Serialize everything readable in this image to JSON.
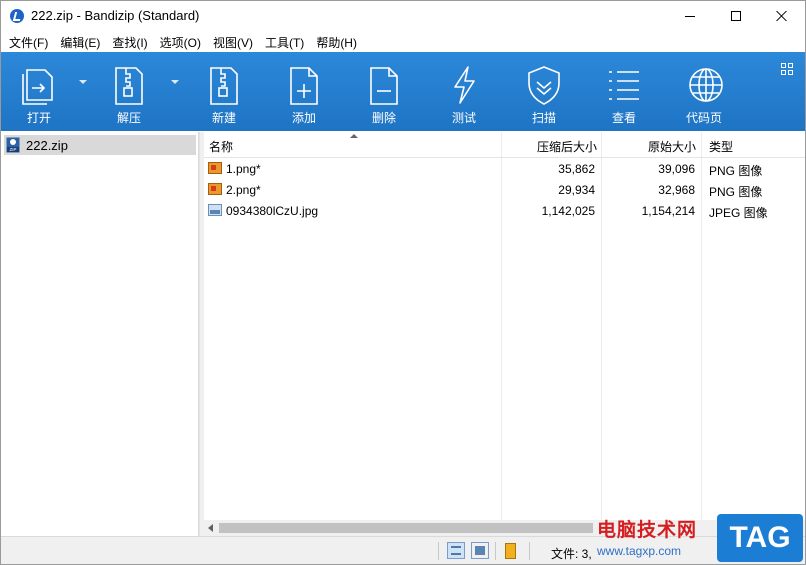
{
  "window": {
    "title": "222.zip - Bandizip (Standard)"
  },
  "menu": [
    "文件(F)",
    "编辑(E)",
    "查找(I)",
    "选项(O)",
    "视图(V)",
    "工具(T)",
    "帮助(H)"
  ],
  "toolbar": {
    "buttons": [
      {
        "label": "打开",
        "icon": "open-archive-icon"
      },
      {
        "label": "解压",
        "icon": "extract-icon"
      },
      {
        "label": "新建",
        "icon": "new-archive-icon"
      },
      {
        "label": "添加",
        "icon": "add-file-icon"
      },
      {
        "label": "删除",
        "icon": "delete-file-icon"
      },
      {
        "label": "测试",
        "icon": "test-lightning-icon"
      },
      {
        "label": "扫描",
        "icon": "scan-shield-icon"
      },
      {
        "label": "查看",
        "icon": "view-list-icon"
      },
      {
        "label": "代码页",
        "icon": "codepage-globe-icon"
      }
    ],
    "accent": "#2580d0"
  },
  "tree": {
    "items": [
      {
        "label": "222.zip",
        "icon": "zip-archive-icon"
      }
    ]
  },
  "list": {
    "columns": [
      "名称",
      "压缩后大小",
      "原始大小",
      "类型"
    ],
    "rows": [
      {
        "name": "1.png*",
        "packed": "35,862",
        "size": "39,096",
        "type": "PNG 图像",
        "icon": "png-file-icon"
      },
      {
        "name": "2.png*",
        "packed": "29,934",
        "size": "32,968",
        "type": "PNG 图像",
        "icon": "png-file-icon"
      },
      {
        "name": "0934380lCzU.jpg",
        "packed": "1,142,025",
        "size": "1,154,214",
        "type": "JPEG 图像",
        "icon": "jpg-file-icon"
      }
    ]
  },
  "status": {
    "text": "文件: 3,"
  },
  "watermark": {
    "text": "电脑技术网",
    "url": "www.tagxp.com",
    "tag": "TAG"
  }
}
